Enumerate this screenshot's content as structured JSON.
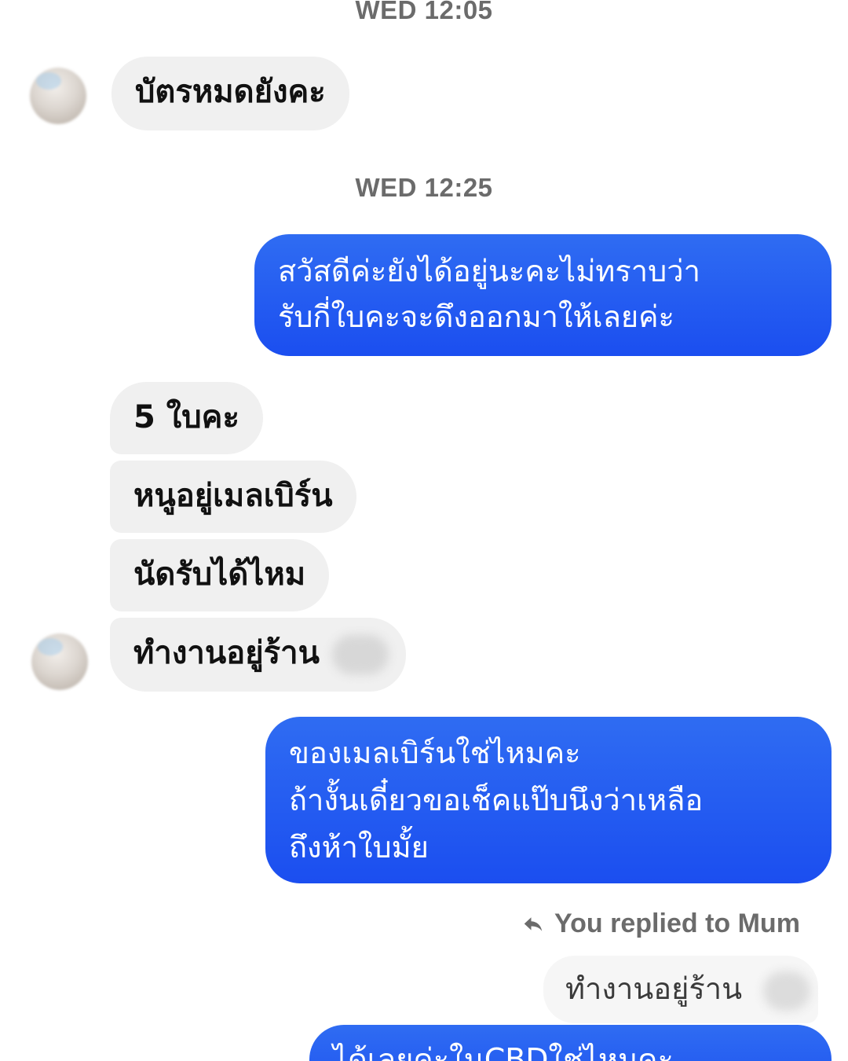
{
  "timestamps": [
    "WED 12:05",
    "WED 12:25"
  ],
  "messages": [
    {
      "direction": "incoming",
      "text": "บัตรหมดยังคะ"
    },
    {
      "direction": "outgoing",
      "lines": [
        "สวัสดีค่ะยังได้อยู่นะคะไม่ทราบว่า",
        "รับกี่ใบคะจะดึงออกมาให้เลยค่ะ"
      ]
    },
    {
      "direction": "incoming",
      "text": "5 ใบคะ"
    },
    {
      "direction": "incoming",
      "text": "หนูอยู่เมลเบิร์น"
    },
    {
      "direction": "incoming",
      "text": "นัดรับได้ไหม"
    },
    {
      "direction": "incoming",
      "text": "ทำงานอยู่ร้าน"
    },
    {
      "direction": "outgoing",
      "lines": [
        "ของเมลเบิร์นใช่ไหมคะ",
        "ถ้างั้นเดี๋ยวขอเช็คแป๊บนึงว่าเหลือ",
        "ถึงห้าใบมั้ย"
      ]
    },
    {
      "direction": "outgoing",
      "text": "ได้เลยค่ะในCBDใช่ไหมคะ"
    }
  ],
  "reply": {
    "header": "You replied to Mum",
    "quoted_text": "ทำงานอยู่ร้าน"
  },
  "icons": {
    "reply": "reply-arrow-icon",
    "avatar": "avatar"
  },
  "colors": {
    "outgoing_bubble": "#1b4ef0",
    "incoming_bubble": "#f0f0f0",
    "timestamp_text": "#6b6b6b"
  }
}
